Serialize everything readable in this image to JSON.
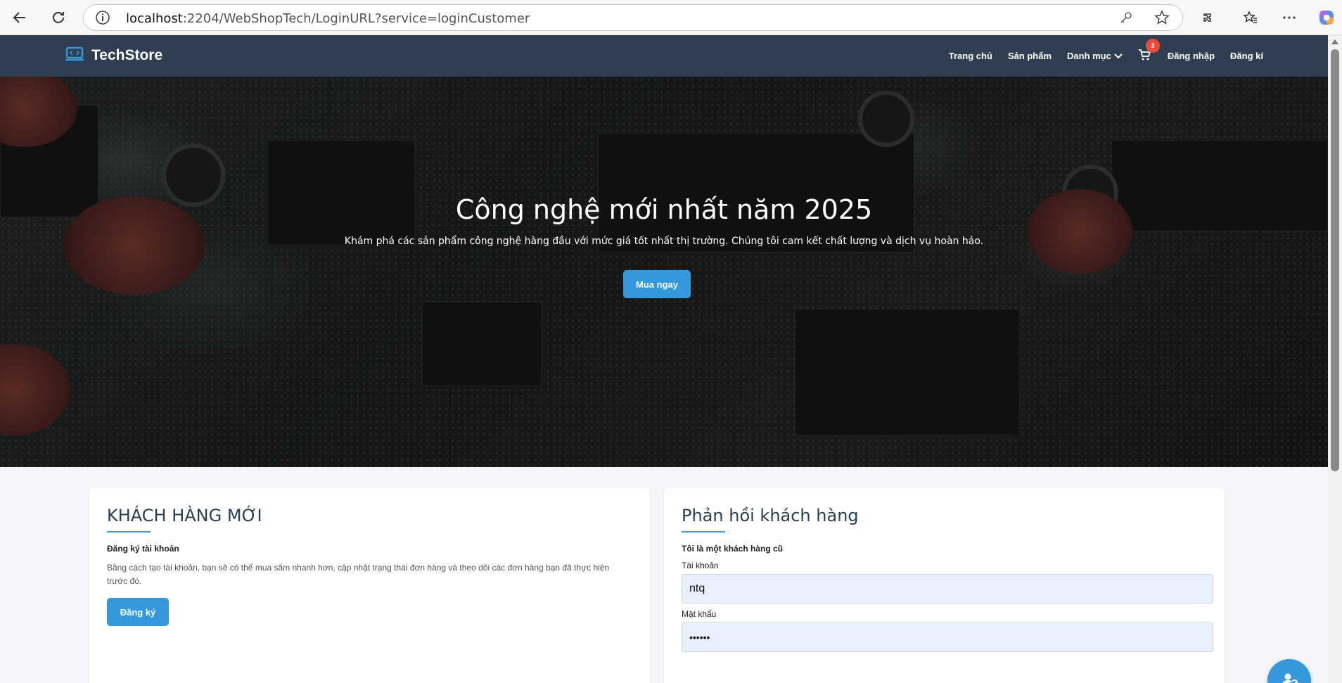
{
  "browser": {
    "url_host": "localhost",
    "url_rest": ":2204/WebShopTech/LoginURL?service=loginCustomer",
    "icons": [
      "back-arrow-icon",
      "reload-icon",
      "info-icon",
      "key-icon",
      "star-icon",
      "extensions-icon",
      "favorites-icon",
      "more-icon",
      "copilot-icon"
    ]
  },
  "navbar": {
    "logo_text": "TechStore",
    "links": {
      "home": "Trang chủ",
      "products": "Sản phẩm",
      "categories": "Danh mục",
      "login": "Đăng nhập",
      "register": "Đăng kí"
    },
    "cart_count": "3"
  },
  "hero": {
    "title": "Công nghệ mới nhất năm 2025",
    "subtitle": "Khám phá các sản phẩm công nghệ hàng đầu với mức giá tốt nhất thị trường. Chúng tôi cam kết chất lượng và dịch vụ hoàn hảo.",
    "button": "Mua ngay"
  },
  "new_customer": {
    "title": "KHÁCH HÀNG MỚI",
    "subtitle": "Đăng ký tài khoản",
    "text": "Bằng cách tạo tài khoản, bạn sẽ có thể mua sắm nhanh hơn, cập nhật trạng thái đơn hàng và theo dõi các đơn hàng bạn đã thực hiện trước đó.",
    "button": "Đăng ký"
  },
  "returning_customer": {
    "title": "Phản hồi khách hàng",
    "subtitle": "Tôi là một khách hàng cũ",
    "username_label": "Tài khoản",
    "username_value": "ntq",
    "password_label": "Mật khẩu",
    "password_value": "••••••"
  },
  "colors": {
    "navbar": "#2f3e50",
    "accent": "#3498db",
    "badge": "#e74c3c",
    "input_bg": "#e8f0fe"
  }
}
